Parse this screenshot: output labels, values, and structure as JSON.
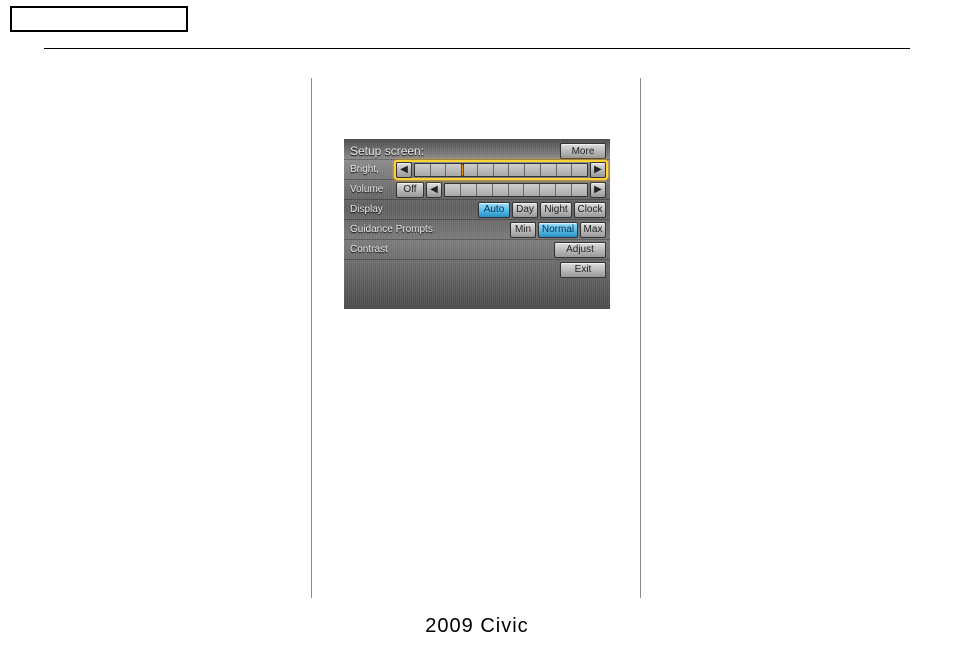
{
  "footer_text": "2009  Civic",
  "screen": {
    "title": "Setup screen:",
    "more": "More",
    "rows": {
      "bright_label": "Bright,",
      "volume_label": "Volume",
      "volume_off": "Off",
      "display_label": "Display",
      "display_auto": "Auto",
      "display_day": "Day",
      "display_night": "Night",
      "display_clock": "Clock",
      "guidance_label": "Guidance Prompts",
      "guidance_min": "Min",
      "guidance_normal": "Normal",
      "guidance_max": "Max",
      "contrast_label": "Contrast",
      "adjust": "Adjust",
      "exit": "Exit"
    },
    "arrows": {
      "left": "◀",
      "right": "▶"
    },
    "bright_slider": {
      "segments": 11,
      "position_pct": 27
    },
    "volume_slider": {
      "segments": 9
    }
  }
}
